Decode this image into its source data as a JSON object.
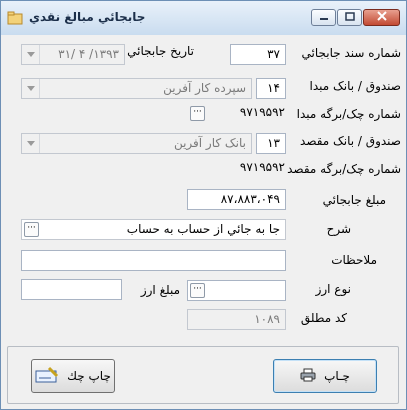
{
  "window": {
    "title": "جابجائي مبالغ نقدي"
  },
  "icons": {
    "app": "app-icon",
    "minimize": "minimize-icon",
    "maximize": "maximize-icon",
    "close": "close-icon",
    "dropdown": "chevron-down-icon",
    "browse": "ellipsis-icon",
    "print": "printer-icon",
    "check_print": "check-print-icon"
  },
  "labels": {
    "doc_number": "شماره سند جابجائي",
    "transfer_date": "تاريخ جابجائي",
    "source_box": "صندوق / بانک مبدا",
    "source_check": "شماره چک/برگه مبدا",
    "dest_box": "صندوق / بانک مقصد",
    "dest_check": "شماره چک/برگه مقصد",
    "amount": "مبلغ جابجائي",
    "description": "شرح",
    "notes": "ملاحظات",
    "currency_type": "نوع ارز",
    "currency_amount": "مبلغ ارز",
    "total_code": "کد مطلق"
  },
  "values": {
    "doc_number": "۳۷",
    "transfer_date": "۱۳۹۳/ ۴ /۳۱",
    "source_code": "۱۴",
    "source_name": "سپرده کار آفرين",
    "source_check": "۹۷۱۹۵۹۲",
    "dest_code": "۱۳",
    "dest_name": "بانک کار آفرين",
    "dest_check": "۹۷۱۹۵۹۲",
    "amount": "۸۷،۸۸۳،۰۴۹",
    "description": "جا به جائي از حساب به حساب",
    "notes": "",
    "currency_type": "",
    "currency_amount": "",
    "total_code": "۱۰۸۹"
  },
  "buttons": {
    "print": "چـاپ",
    "check_print": "چاپ چك"
  }
}
